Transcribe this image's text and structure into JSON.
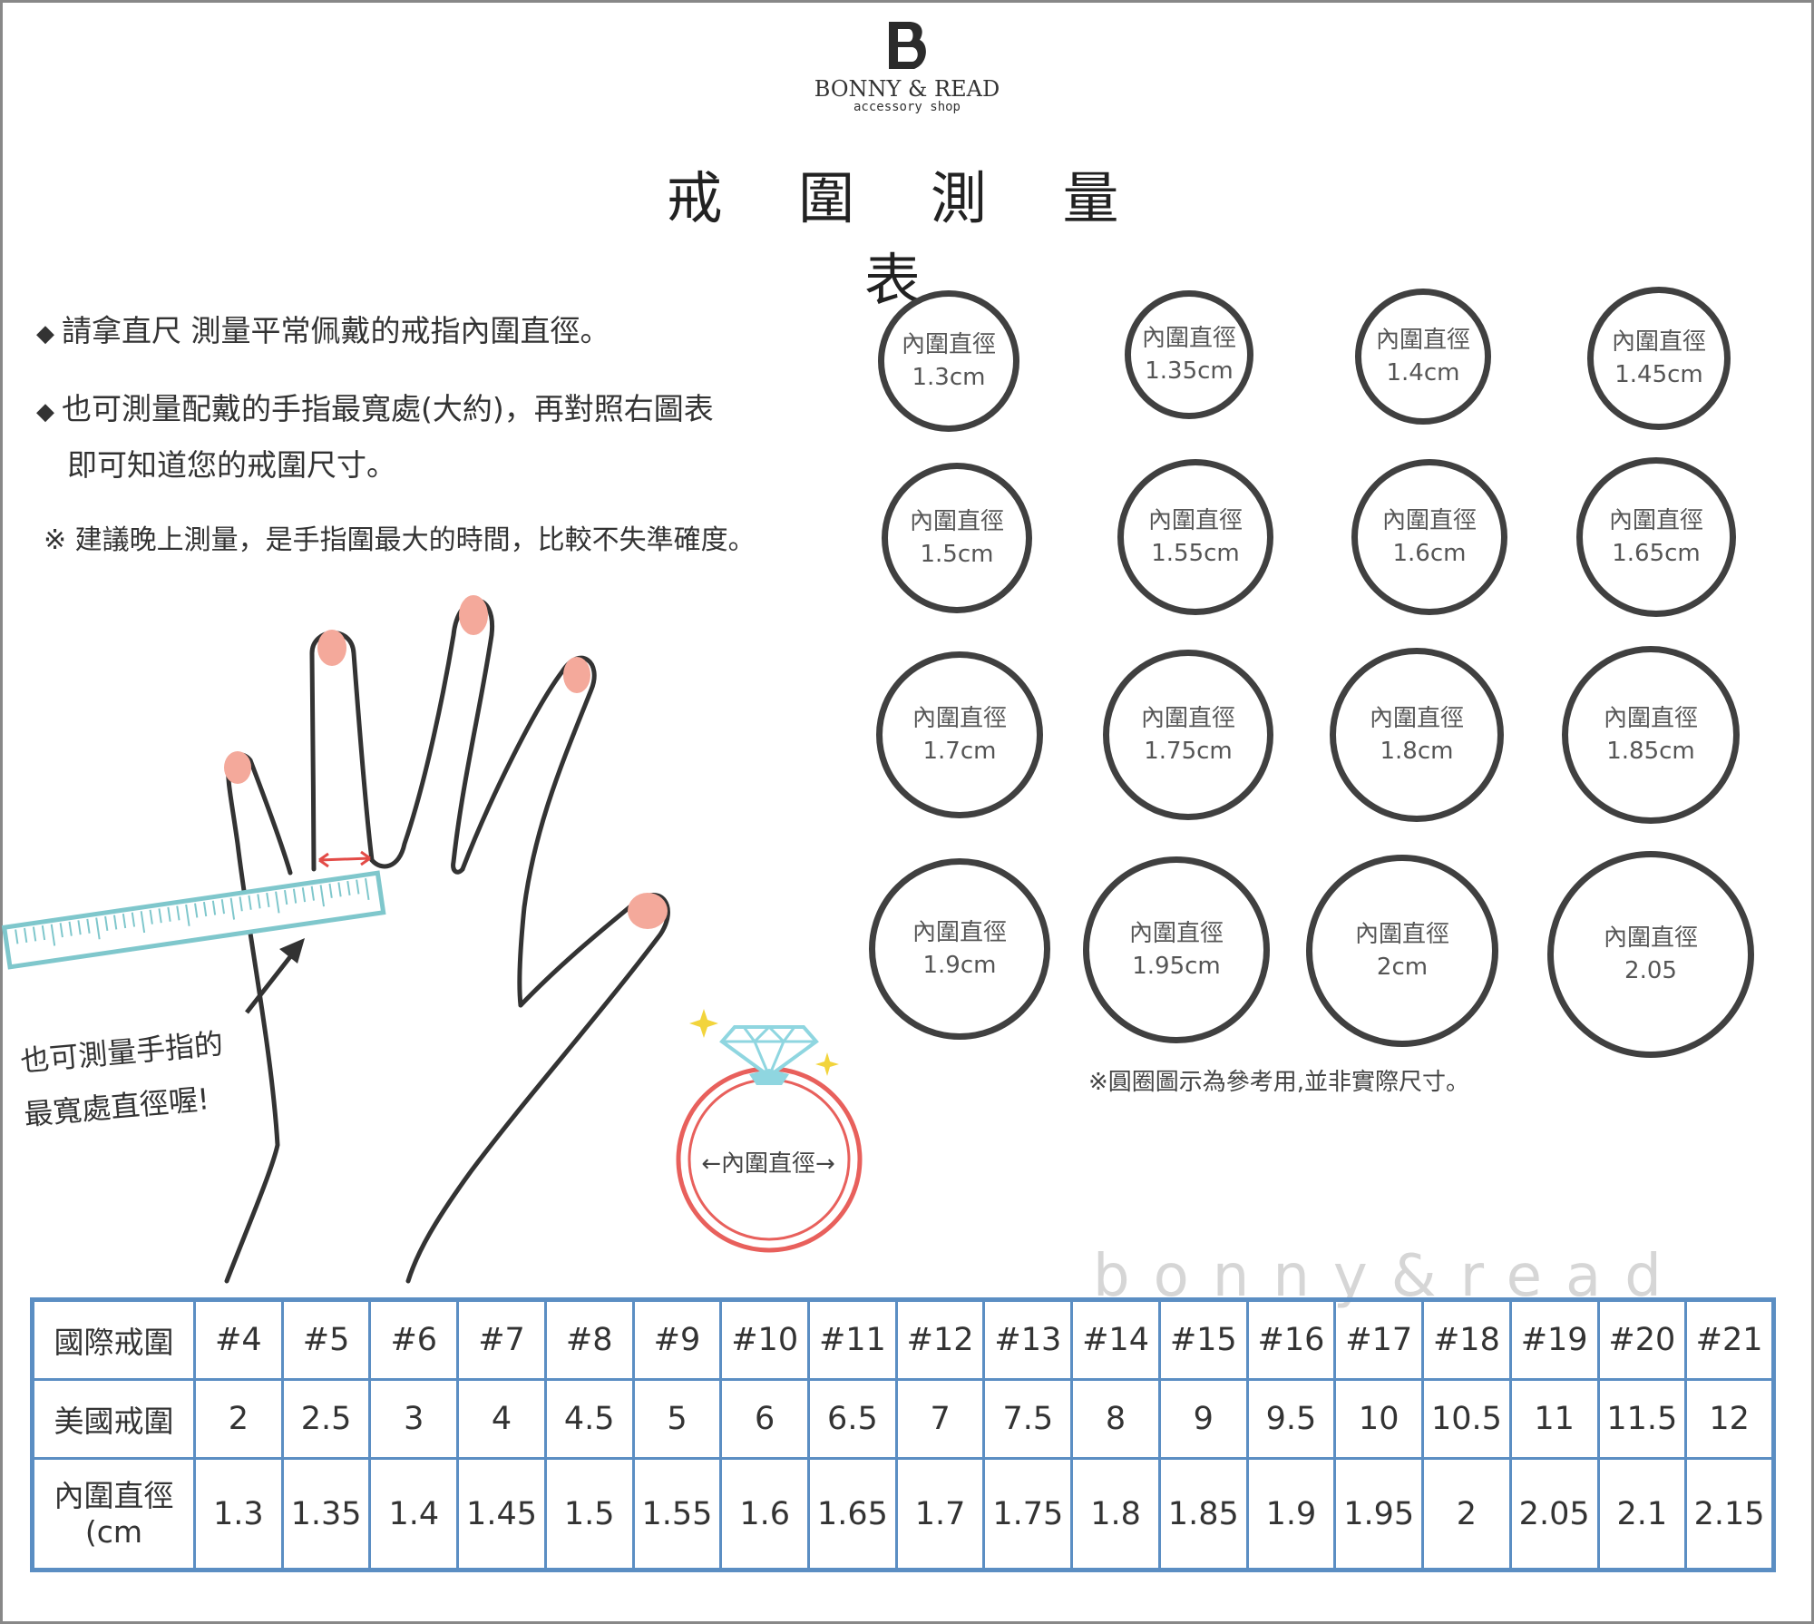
{
  "brand": {
    "logo_letter": "B",
    "name": "BONNY & READ",
    "tagline": "accessory shop"
  },
  "title": "戒 圍 測 量 表",
  "instructions": {
    "line1": "請拿直尺 測量平常佩戴的戒指內圍直徑。",
    "line2": "也可測量配戴的手指最寬處(大約)，再對照右圖表",
    "line3": "即可知道您的戒圍尺寸。",
    "note": "※ 建議晚上測量，是手指圍最大的時間，比較不失準確度。"
  },
  "hand_note": {
    "line1": "也可測量手指的",
    "line2": "最寬處直徑喔!"
  },
  "ring_label": "←內圍直徑→",
  "circle_caption": "內圍直徑",
  "circles": [
    {
      "value": "1.3cm"
    },
    {
      "value": "1.35cm"
    },
    {
      "value": "1.4cm"
    },
    {
      "value": "1.45cm"
    },
    {
      "value": "1.5cm"
    },
    {
      "value": "1.55cm"
    },
    {
      "value": "1.6cm"
    },
    {
      "value": "1.65cm"
    },
    {
      "value": "1.7cm"
    },
    {
      "value": "1.75cm"
    },
    {
      "value": "1.8cm"
    },
    {
      "value": "1.85cm"
    },
    {
      "value": "1.9cm"
    },
    {
      "value": "1.95cm"
    },
    {
      "value": "2cm"
    },
    {
      "value": "2.05"
    }
  ],
  "circle_note": "※圓圈圖示為參考用,並非實際尺寸。",
  "watermark": "bonny&read",
  "table": {
    "row_headers": [
      "國際戒圍",
      "美國戒圍",
      "內圍直徑 (cm"
    ],
    "international": [
      "#4",
      "#5",
      "#6",
      "#7",
      "#8",
      "#9",
      "#10",
      "#11",
      "#12",
      "#13",
      "#14",
      "#15",
      "#16",
      "#17",
      "#18",
      "#19",
      "#20",
      "#21"
    ],
    "us": [
      "2",
      "2.5",
      "3",
      "4",
      "4.5",
      "5",
      "6",
      "6.5",
      "7",
      "7.5",
      "8",
      "9",
      "9.5",
      "10",
      "10.5",
      "11",
      "11.5",
      "12"
    ],
    "diameter": [
      "1.3",
      "1.35",
      "1.4",
      "1.45",
      "1.5",
      "1.55",
      "1.6",
      "1.65",
      "1.7",
      "1.75",
      "1.8",
      "1.85",
      "1.9",
      "1.95",
      "2",
      "2.05",
      "2.1",
      "2.15"
    ]
  },
  "colors": {
    "table_border": "#5b8ec3",
    "ruler": "#7fc7cc",
    "nail": "#f4a99b",
    "ring": "#e8605c",
    "diamond": "#8fd6e0",
    "sparkle": "#f2d43c"
  }
}
